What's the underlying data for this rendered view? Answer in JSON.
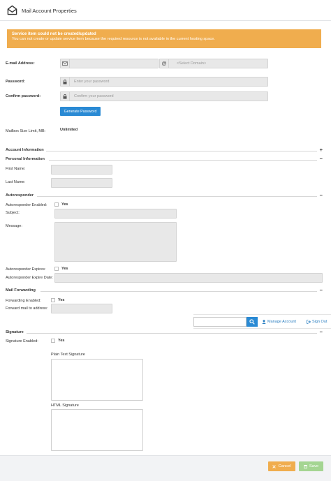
{
  "header": {
    "title": "Mail Account Properties",
    "icon": "envelope-open-icon"
  },
  "alert": {
    "title": "Service item could not be created/updated",
    "message": "You can not create or update service item because the required resource is not available in the current hosting space."
  },
  "form": {
    "email_label": "E-mail Address:",
    "email_value": "",
    "domain_placeholder": "<Select Domain>",
    "password_label": "Password:",
    "password_placeholder": "Enter your password",
    "confirm_label": "Confirm password:",
    "confirm_placeholder": "Confirm your password",
    "generate_button": "Generate Password",
    "mailbox_label": "Mailbox Size Limit, MB:",
    "mailbox_value": "Unlimited"
  },
  "sections": {
    "account_info": "Account Information",
    "account_info_toggle": "+",
    "personal_info": "Personal Information",
    "personal_info_toggle": "−",
    "first_name_label": "First Name:",
    "last_name_label": "Last Name:",
    "autoresponder": "Autoresponder",
    "autoresponder_toggle": "−",
    "autoresponder_enabled_label": "Autoresponder Enabled:",
    "subject_label": "Subject:",
    "message_label": "Message:",
    "autoresponder_expires_label": "Autoresponder Expires:",
    "autoresponder_expire_date_label": "Autoresponder Expire Date:",
    "mail_forwarding": "Mail Forwarding",
    "mail_forwarding_toggle": "−",
    "forwarding_enabled_label": "Forwarding Enabled:",
    "forward_to_label": "Forward mail to address:",
    "signature": "Signature",
    "signature_toggle": "−",
    "signature_enabled_label": "Signature Enabled:",
    "plain_text_signature_label": "Plain Text Signature",
    "html_signature_label": "HTML Signature",
    "yes": "Yes"
  },
  "topbar": {
    "search_placeholder": "",
    "manage_account": "Manage Account",
    "sign_out": "Sign Out"
  },
  "footer": {
    "cancel": "Cancel",
    "save": "Save"
  },
  "colors": {
    "alert": "#f0ad4e",
    "primary": "#2a8ad4",
    "cancel": "#f0ad4e",
    "save": "#a4d592"
  }
}
